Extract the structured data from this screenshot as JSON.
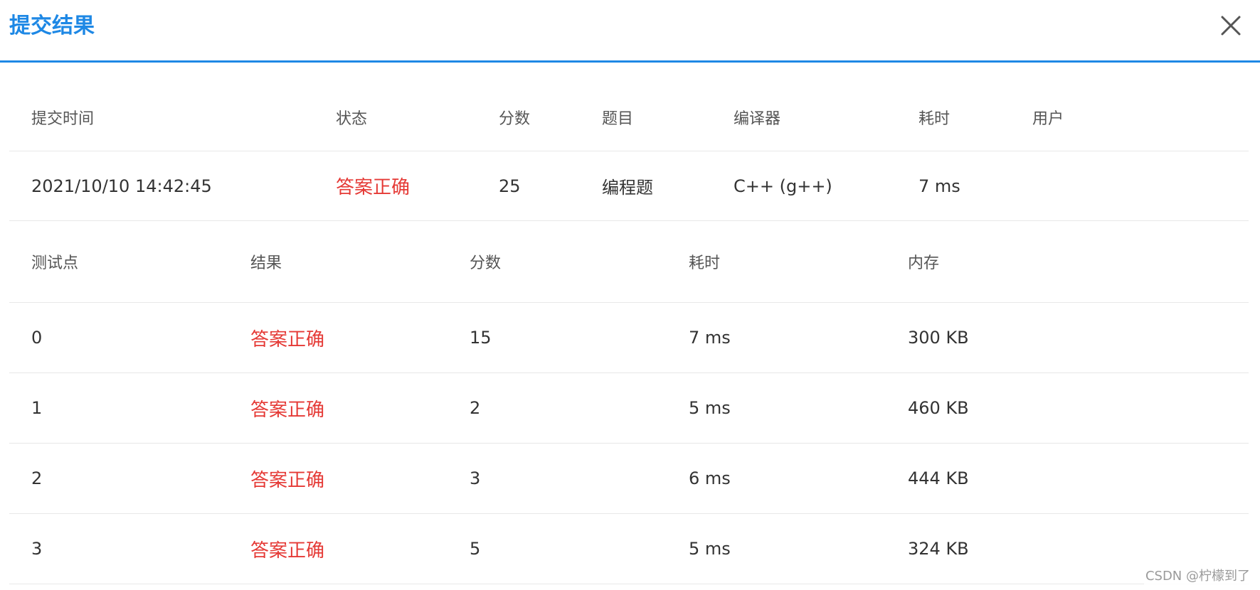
{
  "header": {
    "title": "提交结果",
    "close_icon": "close-icon"
  },
  "summary": {
    "columns": [
      "提交时间",
      "状态",
      "分数",
      "题目",
      "编译器",
      "耗时",
      "用户"
    ],
    "row": {
      "time": "2021/10/10 14:42:45",
      "status": "答案正确",
      "score": "25",
      "problem": "编程题",
      "compiler": "C++ (g++)",
      "duration": "7 ms",
      "user": ""
    }
  },
  "cases": {
    "columns": [
      "测试点",
      "结果",
      "分数",
      "耗时",
      "内存"
    ],
    "rows": [
      {
        "point": "0",
        "result": "答案正确",
        "score": "15",
        "duration": "7 ms",
        "memory": "300 KB"
      },
      {
        "point": "1",
        "result": "答案正确",
        "score": "2",
        "duration": "5 ms",
        "memory": "460 KB"
      },
      {
        "point": "2",
        "result": "答案正确",
        "score": "3",
        "duration": "6 ms",
        "memory": "444 KB"
      },
      {
        "point": "3",
        "result": "答案正确",
        "score": "5",
        "duration": "5 ms",
        "memory": "324 KB"
      }
    ]
  },
  "watermark": "CSDN @柠檬到了",
  "colors": {
    "accent": "#1e88e5",
    "success_text": "#e53935",
    "divider": "#e8e8e8"
  }
}
